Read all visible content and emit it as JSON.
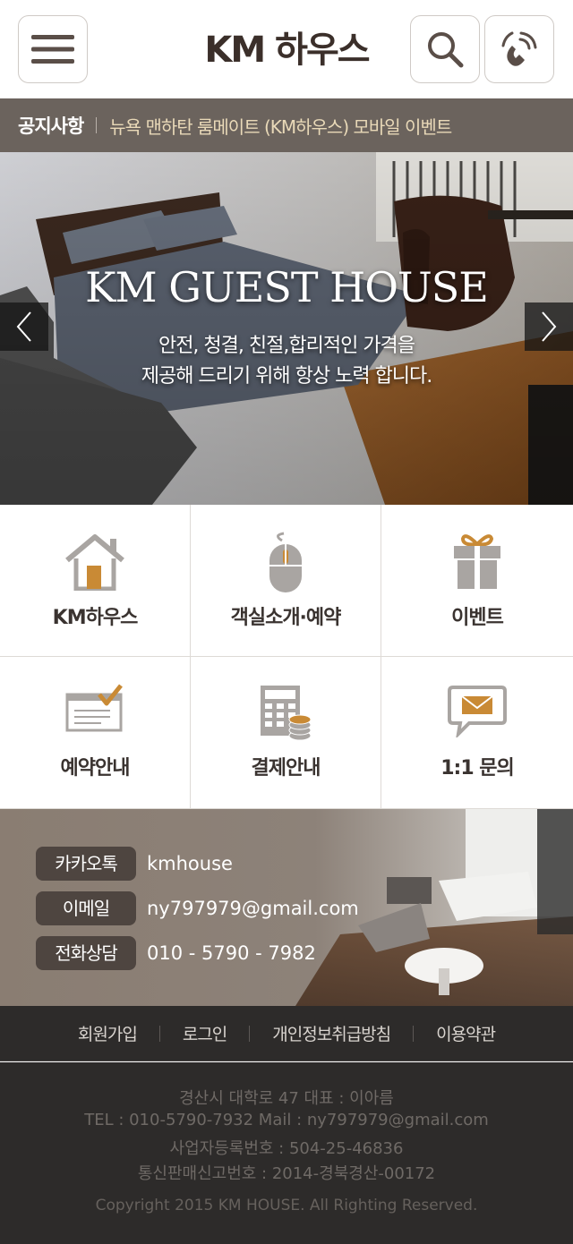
{
  "header": {
    "title": "KM 하우스",
    "menu_icon": "hamburger-menu-icon",
    "search_icon": "search-icon",
    "phone_icon": "phone-call-icon"
  },
  "notice": {
    "label": "공지사항",
    "text": "뉴욕 맨하탄 룸메이트 (KM하우스) 모바일 이벤트"
  },
  "hero": {
    "title": "KM GUEST HOUSE",
    "subtitle_line1": "안전, 청결, 친절,합리적인 가격을",
    "subtitle_line2": "제공해 드리기 위해 항상 노력 합니다."
  },
  "menu": {
    "items": [
      {
        "label": "KM하우스",
        "icon": "house-icon"
      },
      {
        "label": "객실소개·예약",
        "icon": "mouse-icon"
      },
      {
        "label": "이벤트",
        "icon": "gift-icon"
      },
      {
        "label": "예약안내",
        "icon": "reservation-check-icon"
      },
      {
        "label": "결제안내",
        "icon": "calculator-coins-icon"
      },
      {
        "label": "1:1 문의",
        "icon": "mail-chat-icon"
      }
    ]
  },
  "contact": {
    "rows": [
      {
        "label": "카카오톡",
        "value": "kmhouse"
      },
      {
        "label": "이메일",
        "value": "ny797979@gmail.com"
      },
      {
        "label": "전화상담",
        "value": "010 - 5790 - 7982"
      }
    ]
  },
  "footer": {
    "links": [
      "회원가입",
      "로그인",
      "개인정보취급방침",
      "이용약관"
    ],
    "address_line": "경산시 대학로 47  대표 : 이아름",
    "tel_line": "TEL : 010-5790-7932  Mail : ny797979@gmail.com",
    "biz_line": "사업자등록번호 : 504-25-46836",
    "mail_order_line": "통신판매신고번호 : 2014-경북경산-00172",
    "copyright": "Copyright 2015 KM HOUSE. All Righting Reserved."
  },
  "colors": {
    "accent": "#c98a35",
    "icon_gray": "#a9a5a2",
    "dark": "#2d2b2a"
  }
}
